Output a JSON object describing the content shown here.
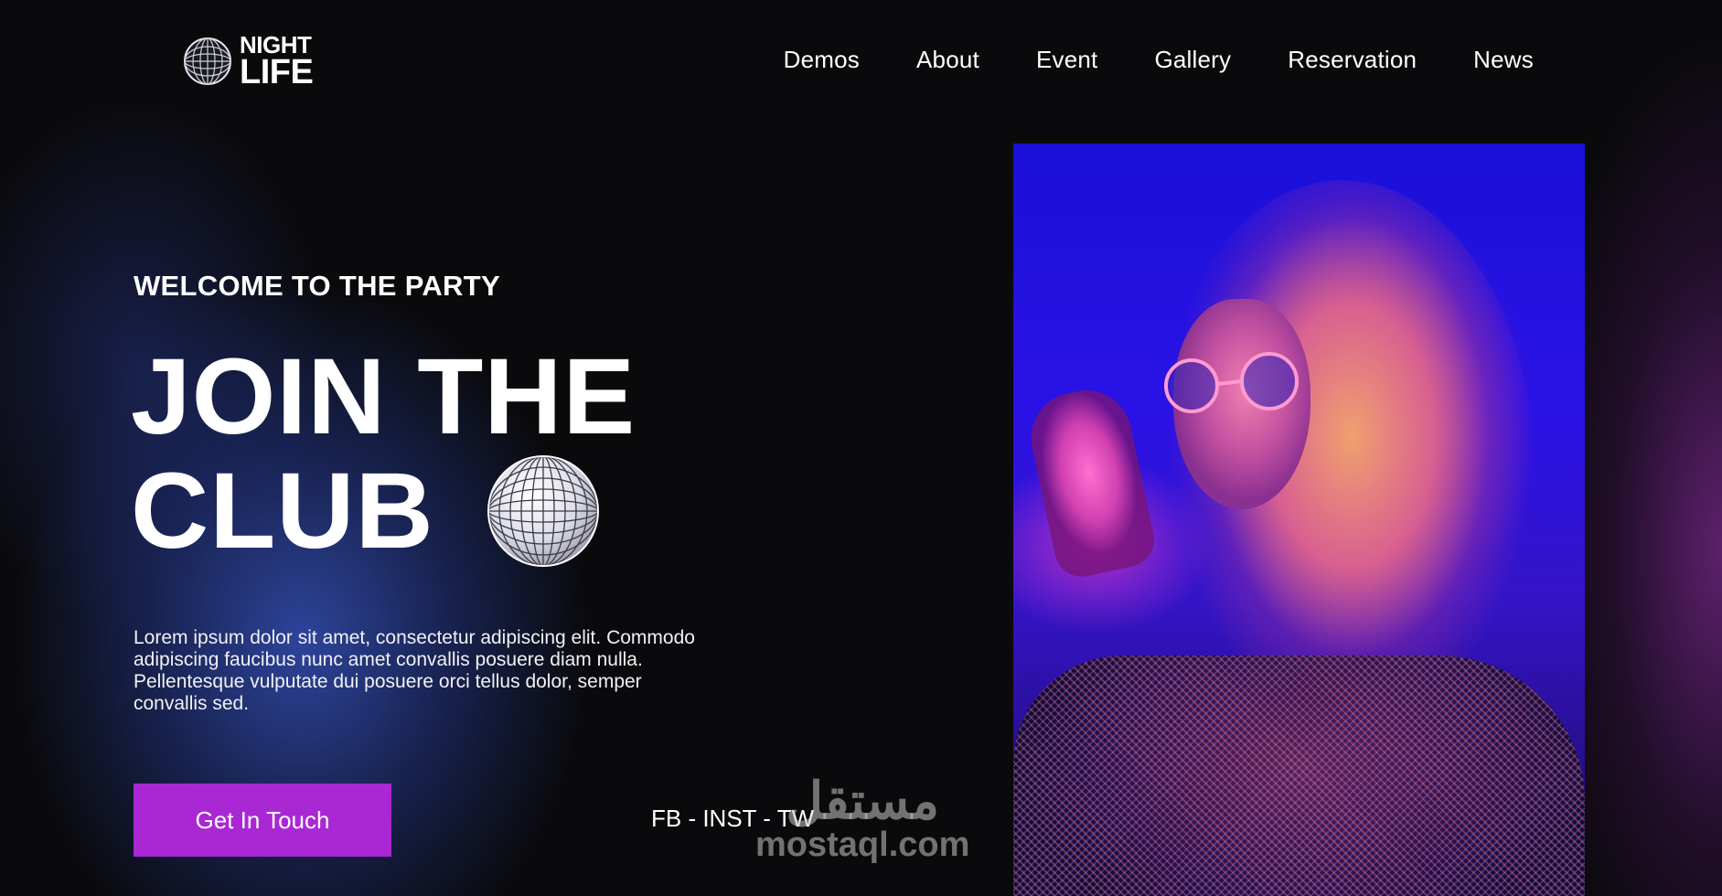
{
  "logo": {
    "line1": "NIGHT",
    "line2": "LIFE",
    "icon": "disco-ball-icon"
  },
  "nav": {
    "items": [
      {
        "label": "Demos"
      },
      {
        "label": "About"
      },
      {
        "label": "Event"
      },
      {
        "label": "Gallery"
      },
      {
        "label": "Reservation"
      },
      {
        "label": "News"
      }
    ]
  },
  "hero": {
    "eyebrow": "WELCOME TO THE PARTY",
    "headline_line1": "JOIN THE",
    "headline_line2": "CLUB",
    "lead": "Lorem ipsum dolor sit amet, consectetur adipiscing elit. Commodo adipiscing faucibus nunc amet convallis posuere diam nulla. Pellentesque vulputate dui posuere orci tellus dolor, semper convallis sed.",
    "cta_label": "Get In Touch",
    "social": "FB - INST - TW",
    "image_alt": "woman-with-sunglasses-photo"
  },
  "watermark": {
    "arabic": "مستقل",
    "latin": "mostaql.com"
  },
  "colors": {
    "accent": "#a928d4",
    "background": "#0a0a0c",
    "glow_blue": "#344eb4",
    "glow_purple": "#78288c"
  }
}
